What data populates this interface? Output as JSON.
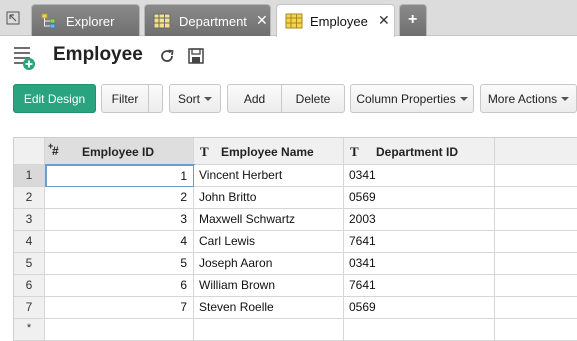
{
  "tabs": [
    {
      "label": "Explorer",
      "icon": "explorer-icon",
      "active": false
    },
    {
      "label": "Department",
      "icon": "table-icon",
      "active": false,
      "closable": true
    },
    {
      "label": "Employee",
      "icon": "table-icon",
      "active": true,
      "closable": true
    }
  ],
  "tab_close_glyph": "✕",
  "header": {
    "title": "Employee"
  },
  "toolbar": {
    "edit_design": "Edit Design",
    "filter": "Filter",
    "sort": "Sort",
    "add": "Add",
    "delete": "Delete",
    "column_properties": "Column Properties",
    "more_actions": "More Actions"
  },
  "grid": {
    "columns": [
      {
        "type_glyph": "#",
        "type_prefix": "+",
        "label": "Employee ID"
      },
      {
        "type_glyph": "T",
        "label": "Employee Name"
      },
      {
        "type_glyph": "T",
        "label": "Department ID"
      }
    ],
    "rows": [
      {
        "num": "1",
        "id": "1",
        "name": "Vincent Herbert",
        "dept": "0341"
      },
      {
        "num": "2",
        "id": "2",
        "name": "John Britto",
        "dept": "0569"
      },
      {
        "num": "3",
        "id": "3",
        "name": "Maxwell Schwartz",
        "dept": "2003"
      },
      {
        "num": "4",
        "id": "4",
        "name": "Carl Lewis",
        "dept": "7641"
      },
      {
        "num": "5",
        "id": "5",
        "name": "Joseph Aaron",
        "dept": "0341"
      },
      {
        "num": "6",
        "id": "6",
        "name": "William Brown",
        "dept": "7641"
      },
      {
        "num": "7",
        "id": "7",
        "name": "Steven Roelle",
        "dept": "0569"
      }
    ],
    "new_row_marker": "*"
  },
  "colors": {
    "accent": "#2aa37f",
    "tab_inactive": "#7d7d7d",
    "selection_border": "#6b9bd1"
  }
}
